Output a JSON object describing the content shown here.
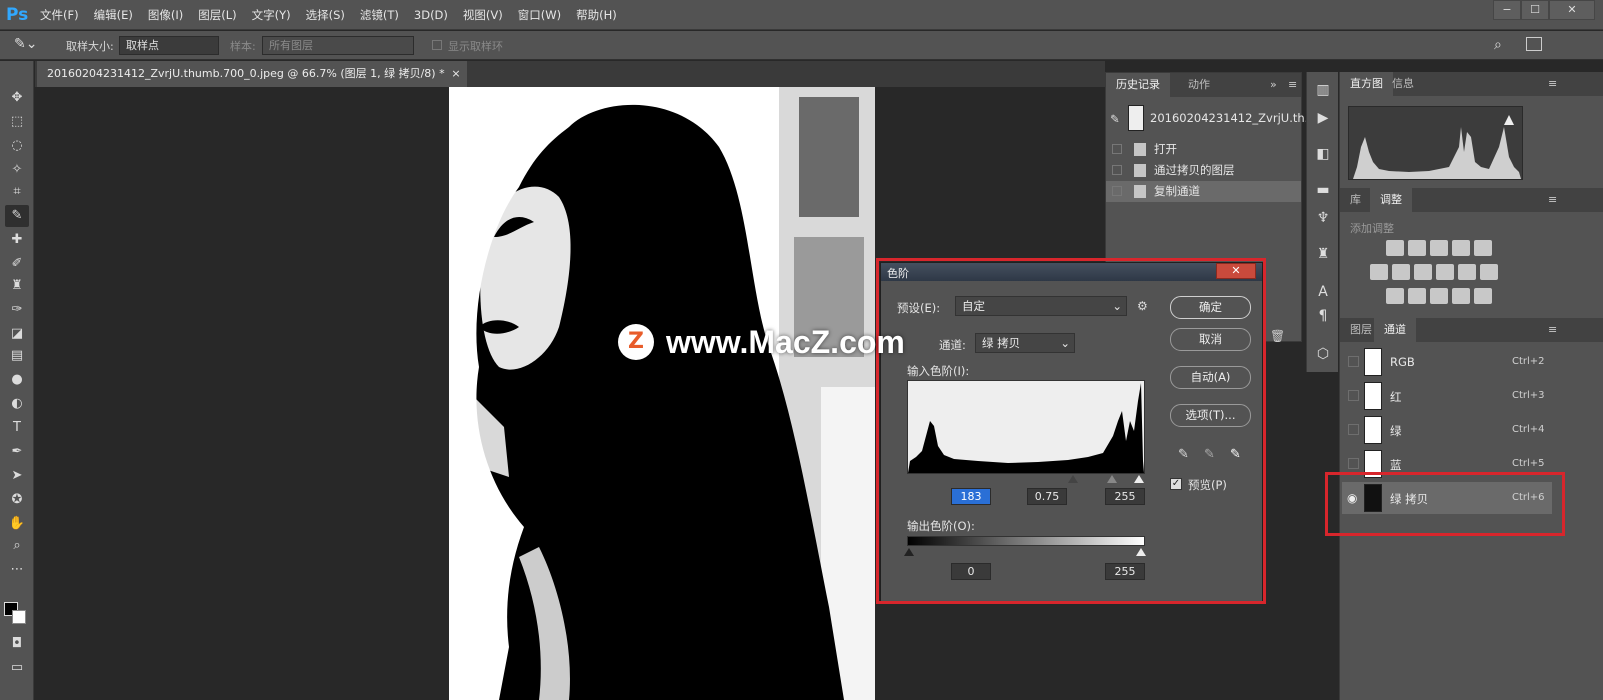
{
  "app": {
    "logo": "Ps"
  },
  "menu": [
    "文件(F)",
    "编辑(E)",
    "图像(I)",
    "图层(L)",
    "文字(Y)",
    "选择(S)",
    "滤镜(T)",
    "3D(D)",
    "视图(V)",
    "窗口(W)",
    "帮助(H)"
  ],
  "window_controls": {
    "minimize": "−",
    "maximize": "☐",
    "close": "✕"
  },
  "options": {
    "sample_size_label": "取样大小:",
    "sample_size_value": "取样点",
    "sample_label": "样本:",
    "sample_value": "所有图层",
    "show_ring_label": "显示取样环"
  },
  "document": {
    "tab_title": "20160204231412_ZvrjU.thumb.700_0.jpeg @ 66.7% (图层 1, 绿 拷贝/8) *",
    "tab_close": "×"
  },
  "history": {
    "tabs": [
      "历史记录",
      "动作"
    ],
    "snapshot": "20160204231412_ZvrjU.th...",
    "items": [
      "打开",
      "通过拷贝的图层",
      "复制通道"
    ]
  },
  "right_panels": {
    "histogram_tabs": [
      "直方图",
      "信息"
    ],
    "adjust_tabs": [
      "库",
      "调整"
    ],
    "adjust_hint": "添加调整",
    "channels_tabs": [
      "图层",
      "通道"
    ],
    "channels": [
      {
        "name": "RGB",
        "shortcut": "Ctrl+2"
      },
      {
        "name": "红",
        "shortcut": "Ctrl+3"
      },
      {
        "name": "绿",
        "shortcut": "Ctrl+4"
      },
      {
        "name": "蓝",
        "shortcut": "Ctrl+5"
      },
      {
        "name": "绿 拷贝",
        "shortcut": "Ctrl+6"
      }
    ]
  },
  "levels": {
    "title": "色阶",
    "close": "✕",
    "preset_label": "预设(E):",
    "preset_value": "自定",
    "channel_label": "通道:",
    "channel_value": "绿 拷贝",
    "input_label": "输入色阶(I):",
    "input_black": "183",
    "input_gamma": "0.75",
    "input_white": "255",
    "output_label": "输出色阶(O):",
    "output_black": "0",
    "output_white": "255",
    "buttons": {
      "ok": "确定",
      "cancel": "取消",
      "auto": "自动(A)",
      "options": "选项(T)..."
    },
    "preview_label": "预览(P)",
    "preview_checked": true
  },
  "watermark": {
    "logo": "Z",
    "text": "www.MacZ.com"
  },
  "colors": {
    "highlight": "#d8262c",
    "ps_blue": "#31a8ff"
  }
}
